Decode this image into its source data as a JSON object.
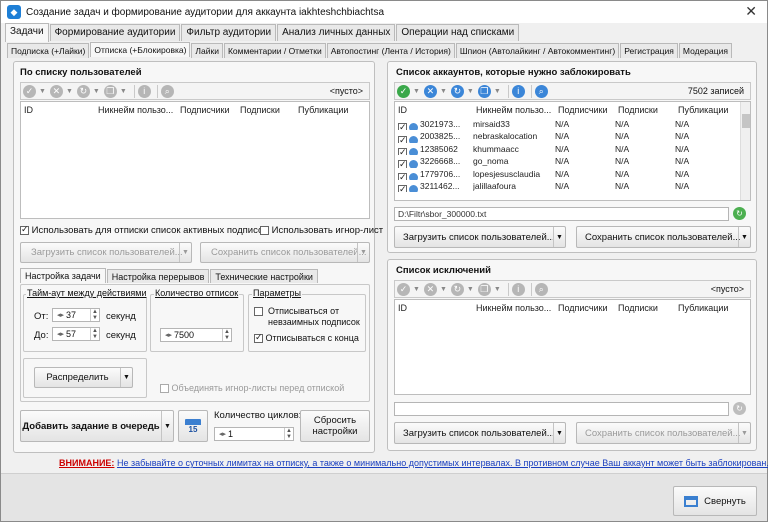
{
  "window": {
    "title": "Создание задач и формирование аудитории для аккаунта iakhteshchbiachtsa",
    "close": "✕"
  },
  "main_tabs": [
    "Задачи",
    "Формирование аудитории",
    "Фильтр аудитории",
    "Анализ личных данных",
    "Операции над списками"
  ],
  "sub_tabs": [
    "Подписка (+Лайки)",
    "Отписка (+Блокировка)",
    "Лайки",
    "Комментарии / Отметки",
    "Автопостинг (Лента / История)",
    "Шпион (Автолайкинг / Автокомментинг)",
    "Регистрация",
    "Модерация"
  ],
  "left": {
    "title": "По списку пользователей",
    "empty": "<пусто>",
    "columns": [
      "ID",
      "Никнейм пользо...",
      "Подписчики",
      "Подписки",
      "Публикации"
    ],
    "use_active_subs": "Использовать для отписки список активных подписок",
    "use_ignore": "Использовать игнор-лист",
    "load_btn": "Загрузить список пользователей...",
    "save_btn": "Сохранить список пользователей...",
    "settings_tabs": [
      "Настройка задачи",
      "Настройка перерывов",
      "Технические настройки"
    ],
    "timeout": {
      "label": "Тайм-аут между действиями",
      "from_label": "От:",
      "from_val": "37",
      "to_label": "До:",
      "to_val": "57",
      "unit": "секунд"
    },
    "count": {
      "label": "Количество отписок",
      "value": "7500"
    },
    "params": {
      "label": "Параметры",
      "opt1": "Отписываться от невзаимных подписок",
      "opt2": "Отписываться с конца"
    },
    "distribute": "Распределить",
    "merge_ignore": "Объединять игнор-листы перед отпиской",
    "add_task": "Добавить задание в очередь",
    "calendar_num": "15",
    "cycles_label": "Количество циклов:",
    "cycles_val": "1",
    "reset": "Сбросить настройки"
  },
  "right_top": {
    "title": "Список аккаунтов, которые нужно заблокировать",
    "count": "7502 записей",
    "columns": [
      "ID",
      "Никнейм пользо...",
      "Подписчики",
      "Подписки",
      "Публикации"
    ],
    "rows": [
      {
        "id": "3021973...",
        "nick": "mirsaid33",
        "subs": "N/A",
        "following": "N/A",
        "posts": "N/A"
      },
      {
        "id": "2003825...",
        "nick": "nebraskalocation",
        "subs": "N/A",
        "following": "N/A",
        "posts": "N/A"
      },
      {
        "id": "12385062",
        "nick": "khummaacc",
        "subs": "N/A",
        "following": "N/A",
        "posts": "N/A"
      },
      {
        "id": "3226668...",
        "nick": "go_noma",
        "subs": "N/A",
        "following": "N/A",
        "posts": "N/A"
      },
      {
        "id": "1779706...",
        "nick": "lopesjesusclaudia",
        "subs": "N/A",
        "following": "N/A",
        "posts": "N/A"
      },
      {
        "id": "3211462...",
        "nick": "jalillaafoura",
        "subs": "N/A",
        "following": "N/A",
        "posts": "N/A"
      }
    ],
    "path": "D:\\Filtr\\sbor_300000.txt",
    "load_btn": "Загрузить список пользователей...",
    "save_btn": "Сохранить список пользователей..."
  },
  "right_bottom": {
    "title": "Список исключений",
    "empty": "<пусто>",
    "columns": [
      "ID",
      "Никнейм пользо...",
      "Подписчики",
      "Подписки",
      "Публикации"
    ],
    "load_btn": "Загрузить список пользователей...",
    "save_btn": "Сохранить список пользователей..."
  },
  "warning": {
    "label": "ВНИМАНИЕ:",
    "text": "Не забывайте о суточных лимитах на отписку, а также о минимально допустимых интервалах. В противном случае Ваш аккаунт может быть заблокирован."
  },
  "collapse_btn": "Свернуть"
}
